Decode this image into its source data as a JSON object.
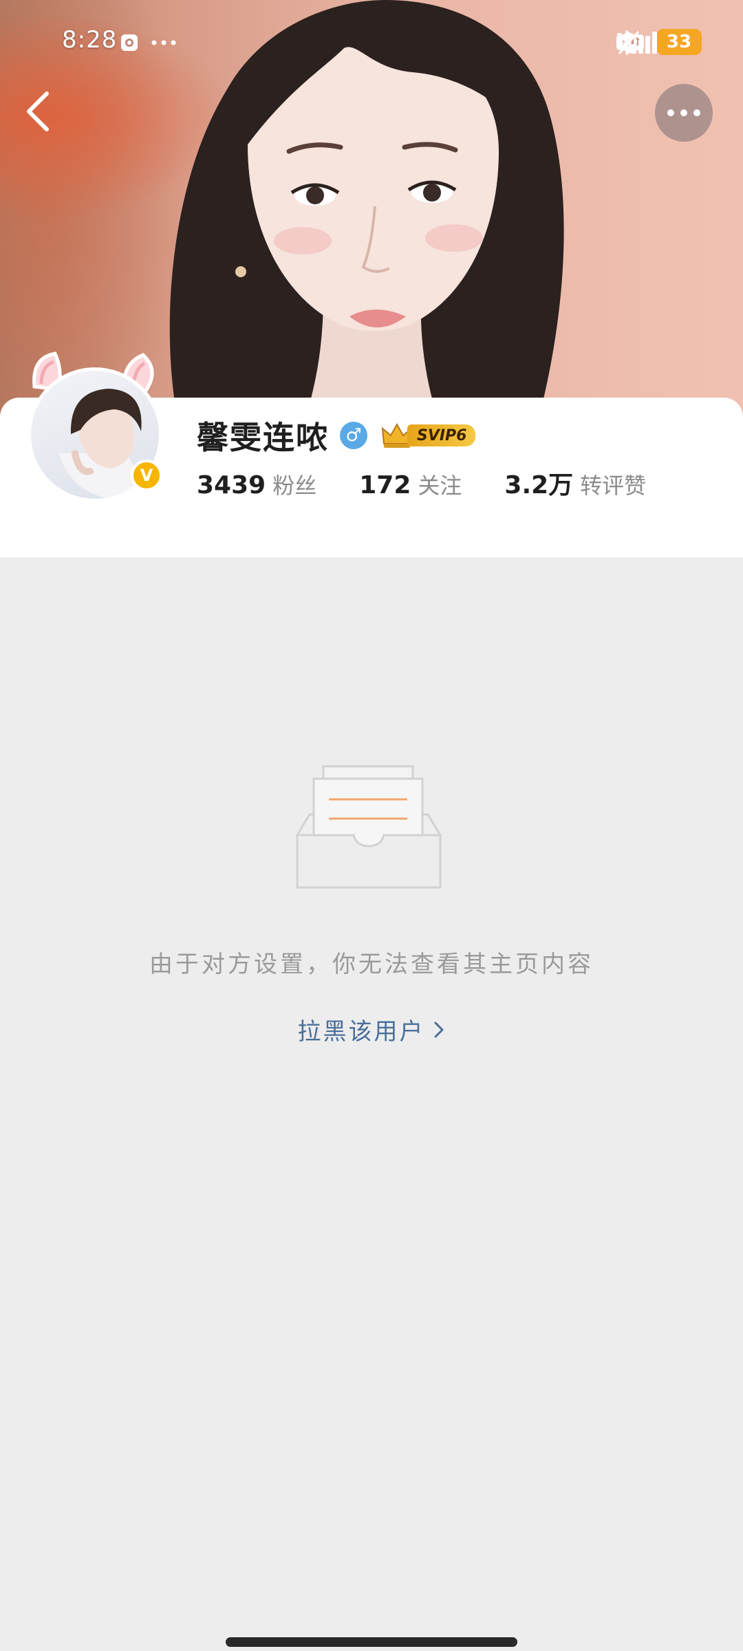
{
  "status_bar": {
    "time": "8:28",
    "left_icons": [
      "camera-icon",
      "more-dots-icon"
    ],
    "right_icons": [
      "bluetooth-icon",
      "mute-bell-icon",
      "hd-icon",
      "signal-5g-icon"
    ],
    "hd_label": "HD",
    "battery_level": "33",
    "battery_color": "#f5a623"
  },
  "nav": {
    "back_icon": "chevron-left-icon",
    "more_icon": "more-dots-icon"
  },
  "profile": {
    "username": "馨雯连哝",
    "gender_symbol": "♂",
    "gender_color": "#5aa9e6",
    "vip_label": "SVIP6",
    "verified_symbol": "V",
    "verified_color": "#f7b500",
    "stats": [
      {
        "value": "3439",
        "label": "粉丝"
      },
      {
        "value": "172",
        "label": "关注"
      },
      {
        "value": "3.2万",
        "label": "转评赞"
      }
    ]
  },
  "empty_state": {
    "icon": "empty-inbox-icon",
    "message": "由于对方设置，你无法查看其主页内容",
    "block_link": "拉黑该用户",
    "link_color": "#4a6f99"
  }
}
